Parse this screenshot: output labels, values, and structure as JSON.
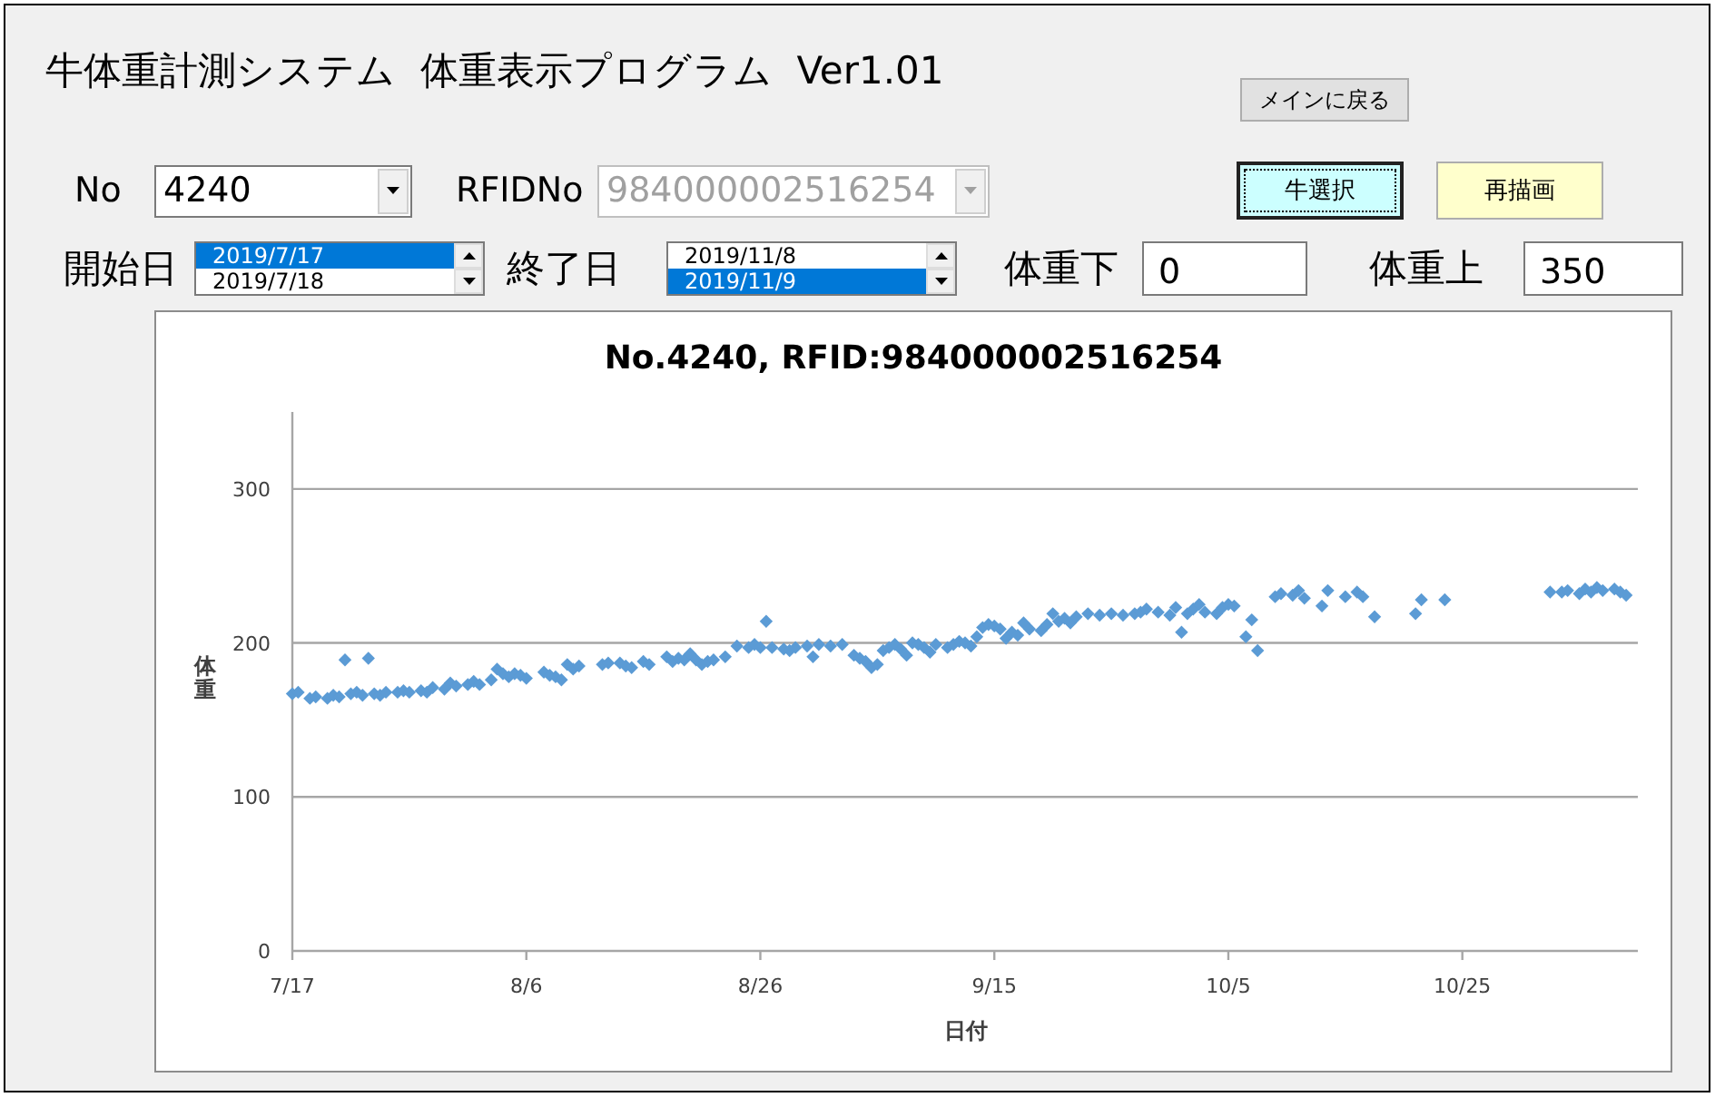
{
  "window": {
    "title": "牛体重計測システム  体重表示プログラム  Ver1.01"
  },
  "buttons": [
    {
      "label": "メインに戻る",
      "kind": "small",
      "focused": false,
      "color": "#e1e1e1"
    },
    {
      "label": "牛選択",
      "kind": "large",
      "focused": true,
      "color": "#ccffff"
    },
    {
      "label": "再描画",
      "kind": "large",
      "focused": false,
      "color": "#ffffcc"
    }
  ],
  "no": {
    "label": "No",
    "value": "4240",
    "disabled": false
  },
  "rfid": {
    "label": "RFIDNo",
    "value": "984000002516254",
    "disabled": true
  },
  "start_date": {
    "label": "開始日",
    "items": [
      {
        "text": "2019/7/17",
        "selected": true
      },
      {
        "text": "2019/7/18",
        "selected": false
      }
    ]
  },
  "end_date": {
    "label": "終了日",
    "items": [
      {
        "text": "2019/11/8",
        "selected": false
      },
      {
        "text": "2019/11/9",
        "selected": true
      }
    ]
  },
  "weight_min": {
    "label": "体重下",
    "value": "0"
  },
  "weight_max": {
    "label": "体重上",
    "value": "350"
  },
  "chart": {
    "chart_data": {
      "type": "scatter",
      "title": "No.4240, RFID:984000002516254",
      "xlabel": "日付",
      "ylabel": "体重",
      "categories": [
        "7/17",
        null,
        null,
        null,
        null,
        null,
        null,
        null,
        null,
        null,
        null,
        null,
        null,
        null,
        null,
        null,
        null,
        null,
        null,
        null,
        null,
        null,
        null,
        null,
        null,
        null,
        null,
        null,
        null,
        null,
        null,
        null,
        null,
        null,
        null,
        null,
        null,
        null,
        null,
        null,
        "8/6",
        null,
        null,
        null,
        null,
        null,
        null,
        null,
        null,
        null,
        null,
        null,
        null,
        null,
        null,
        null,
        null,
        null,
        null,
        null,
        null,
        null,
        null,
        null,
        null,
        null,
        null,
        null,
        null,
        null,
        null,
        null,
        null,
        null,
        null,
        null,
        null,
        null,
        null,
        null,
        "8/26",
        null,
        null,
        null,
        null,
        null,
        null,
        null,
        null,
        null,
        null,
        null,
        null,
        null,
        null,
        null,
        null,
        null,
        null,
        null,
        null,
        null,
        null,
        null,
        null,
        null,
        null,
        null,
        null,
        null,
        null,
        null,
        null,
        null,
        null,
        null,
        null,
        null,
        null,
        null,
        "9/15",
        null,
        null,
        null,
        null,
        null,
        null,
        null,
        null,
        null,
        null,
        null,
        null,
        null,
        null,
        null,
        null,
        null,
        null,
        null,
        null,
        null,
        null,
        null,
        null,
        null,
        null,
        null,
        null,
        null,
        null,
        null,
        null,
        null,
        null,
        null,
        null,
        null,
        null,
        null,
        "10/5",
        null,
        null,
        null,
        null,
        null,
        null,
        null,
        null,
        null,
        null,
        null,
        null,
        null,
        null,
        null,
        null,
        null,
        null,
        null,
        null,
        null,
        null,
        null,
        null,
        null,
        null,
        null,
        null,
        null,
        null,
        null,
        null,
        null,
        null,
        null,
        null,
        null,
        null,
        null,
        "10/25",
        null,
        null,
        null,
        null,
        null,
        null,
        null,
        null,
        null,
        null,
        null,
        null,
        null,
        null,
        null,
        null,
        null,
        null,
        null,
        null,
        null,
        null,
        null,
        null,
        null,
        null,
        null,
        null,
        null,
        null
      ],
      "series": [
        {
          "color": "#5b9bd5",
          "values": [
            167,
            168,
            null,
            164,
            165,
            null,
            164,
            166,
            165,
            189,
            167,
            168,
            166,
            190,
            167,
            166,
            168,
            null,
            168,
            169,
            168,
            null,
            169,
            168,
            171,
            null,
            170,
            174,
            172,
            null,
            173,
            175,
            173,
            null,
            176,
            183,
            180,
            178,
            180,
            179,
            177,
            null,
            null,
            181,
            179,
            178,
            176,
            186,
            183,
            185,
            null,
            null,
            null,
            186,
            187,
            null,
            187,
            185,
            184,
            null,
            188,
            186,
            null,
            null,
            191,
            188,
            190,
            189,
            193,
            189,
            186,
            188,
            189,
            null,
            191,
            null,
            198,
            null,
            197,
            199,
            197,
            214,
            197,
            null,
            196,
            195,
            197,
            null,
            198,
            191,
            199,
            null,
            198,
            null,
            199,
            null,
            192,
            190,
            188,
            184,
            186,
            195,
            197,
            199,
            196,
            192,
            200,
            199,
            197,
            194,
            199,
            null,
            197,
            199,
            201,
            200,
            198,
            204,
            210,
            212,
            211,
            209,
            203,
            207,
            205,
            213,
            209,
            null,
            208,
            212,
            219,
            214,
            216,
            213,
            217,
            null,
            219,
            null,
            218,
            null,
            219,
            null,
            218,
            null,
            219,
            220,
            222,
            null,
            220,
            null,
            218,
            223,
            207,
            219,
            222,
            225,
            220,
            null,
            219,
            223,
            225,
            224,
            null,
            204,
            215,
            195,
            null,
            null,
            230,
            232,
            null,
            231,
            234,
            229,
            null,
            null,
            224,
            234,
            null,
            null,
            230,
            null,
            233,
            230,
            null,
            217,
            null,
            null,
            null,
            null,
            null,
            null,
            219,
            228,
            null,
            null,
            null,
            228,
            null,
            null,
            null,
            null,
            null,
            null,
            null,
            null,
            null,
            null,
            null,
            null,
            null,
            null,
            null,
            null,
            null,
            233,
            null,
            233,
            234,
            null,
            232,
            235,
            233,
            236,
            234,
            null,
            235,
            233,
            231,
            null,
            null
          ]
        }
      ],
      "ylim": [
        0,
        350
      ],
      "yticks": [
        0,
        100,
        200,
        300
      ],
      "grid": true
    }
  }
}
